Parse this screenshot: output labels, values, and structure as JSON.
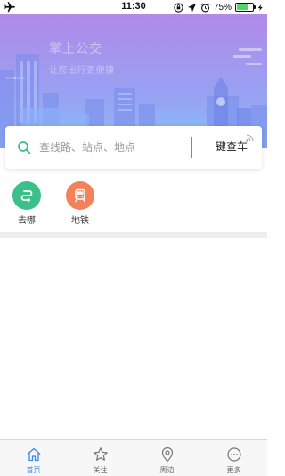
{
  "status_bar": {
    "time": "11:30",
    "battery_percent": "75%",
    "battery_level": 0.75,
    "icons": [
      "airplane-icon",
      "orientation-lock-icon",
      "location-arrow-icon",
      "alarm-icon",
      "charging-bolt-icon"
    ]
  },
  "banner": {
    "title": "掌上公交",
    "subtitle": "让您出行更便捷"
  },
  "search": {
    "placeholder": "查线路、站点、地点",
    "quick_button_label": "一键查车",
    "icon": "search-icon"
  },
  "shortcuts": [
    {
      "label": "去哪",
      "icon": "route-icon",
      "color": "#3dbf8a"
    },
    {
      "label": "地铁",
      "icon": "metro-train-icon",
      "color": "#f2825a"
    }
  ],
  "tab_bar": {
    "active_color": "#3b8be6",
    "tabs": [
      {
        "label": "首页",
        "icon": "home-icon",
        "active": true
      },
      {
        "label": "关注",
        "icon": "star-icon",
        "active": false
      },
      {
        "label": "周边",
        "icon": "location-pin-icon",
        "active": false
      },
      {
        "label": "更多",
        "icon": "more-dots-icon",
        "active": false
      }
    ]
  }
}
